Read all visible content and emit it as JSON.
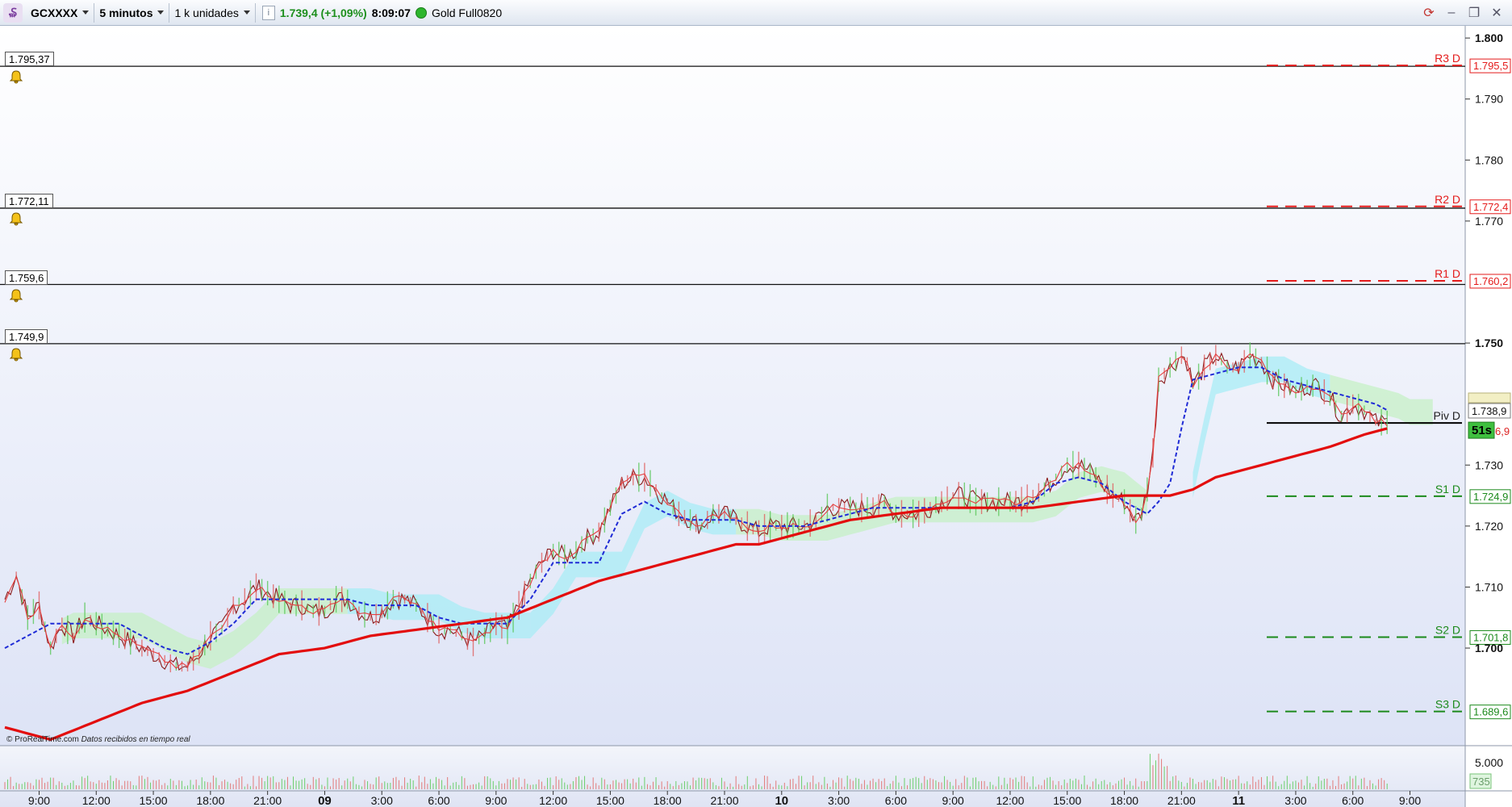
{
  "toolbar": {
    "instrument": "GCXXXX",
    "timeframe": "5 minutos",
    "units": "1 k unidades",
    "info_icon": "i",
    "price": "1.739,4 (+1,09%)",
    "time": "8:09:07",
    "product": "Gold Full0820"
  },
  "attribution": {
    "brand": "© ProRealTime.com",
    "note": "Datos recibidos en tiempo real"
  },
  "alerts": [
    {
      "label": "1.795,37",
      "value": 1795.37
    },
    {
      "label": "1.772,11",
      "value": 1772.11
    },
    {
      "label": "1.759,6",
      "value": 1759.6
    },
    {
      "label": "1.749,9",
      "value": 1749.9
    }
  ],
  "pivots": [
    {
      "name": "R3 D",
      "value": 1795.5,
      "label": "1.795,5",
      "color": "#e41b1b"
    },
    {
      "name": "R2 D",
      "value": 1772.4,
      "label": "1.772,4",
      "color": "#e41b1b"
    },
    {
      "name": "R1 D",
      "value": 1760.2,
      "label": "1.760,2",
      "color": "#e41b1b"
    },
    {
      "name": "Piv D",
      "value": 1736.9,
      "label": "",
      "color": "#000000"
    },
    {
      "name": "S1 D",
      "value": 1724.9,
      "label": "1.724,9",
      "color": "#1c8a1c"
    },
    {
      "name": "S2 D",
      "value": 1701.8,
      "label": "1.701,8",
      "color": "#1c8a1c"
    },
    {
      "name": "S3 D",
      "value": 1689.6,
      "label": "1.689,6",
      "color": "#1c8a1c"
    }
  ],
  "current_price_label": "1.738,9",
  "countdown": "51s",
  "partial_label": "6,9",
  "volume_axis": {
    "tick": "5.000",
    "current": "735"
  },
  "colors": {
    "sma": "#e30d0d",
    "kijun": "#1f2bd6",
    "price": "#8b1a1a",
    "cloud_bull": "#c5f0c5",
    "cloud_bear": "#a8ecf5"
  },
  "chart_data": {
    "type": "line",
    "ylim": [
      1684,
      1802
    ],
    "y_ticks": [
      {
        "v": 1800,
        "t": "1.800",
        "bold": true
      },
      {
        "v": 1790,
        "t": "1.790"
      },
      {
        "v": 1780,
        "t": "1.780"
      },
      {
        "v": 1770,
        "t": "1.770"
      },
      {
        "v": 1750,
        "t": "1.750",
        "bold": true
      },
      {
        "v": 1730,
        "t": "1.730"
      },
      {
        "v": 1720,
        "t": "1.720"
      },
      {
        "v": 1710,
        "t": "1.710"
      },
      {
        "v": 1700,
        "t": "1.700",
        "bold": true
      }
    ],
    "x_ticks": [
      {
        "i": 6,
        "t": "9:00"
      },
      {
        "i": 16,
        "t": "12:00"
      },
      {
        "i": 26,
        "t": "15:00"
      },
      {
        "i": 36,
        "t": "18:00"
      },
      {
        "i": 46,
        "t": "21:00"
      },
      {
        "i": 56,
        "t": "09",
        "bold": true
      },
      {
        "i": 66,
        "t": "3:00"
      },
      {
        "i": 76,
        "t": "6:00"
      },
      {
        "i": 86,
        "t": "9:00"
      },
      {
        "i": 96,
        "t": "12:00"
      },
      {
        "i": 106,
        "t": "15:00"
      },
      {
        "i": 116,
        "t": "18:00"
      },
      {
        "i": 126,
        "t": "21:00"
      },
      {
        "i": 136,
        "t": "10",
        "bold": true
      },
      {
        "i": 146,
        "t": "3:00"
      },
      {
        "i": 156,
        "t": "6:00"
      },
      {
        "i": 166,
        "t": "9:00"
      },
      {
        "i": 176,
        "t": "12:00"
      },
      {
        "i": 186,
        "t": "15:00"
      },
      {
        "i": 196,
        "t": "18:00"
      },
      {
        "i": 206,
        "t": "21:00"
      },
      {
        "i": 216,
        "t": "11",
        "bold": true
      },
      {
        "i": 226,
        "t": "3:00"
      },
      {
        "i": 236,
        "t": "6:00"
      },
      {
        "i": 246,
        "t": "9:00"
      }
    ],
    "price_points": [
      [
        0,
        1708
      ],
      [
        2,
        1712
      ],
      [
        4,
        1705
      ],
      [
        6,
        1707
      ],
      [
        8,
        1700
      ],
      [
        10,
        1704
      ],
      [
        12,
        1702
      ],
      [
        14,
        1705
      ],
      [
        16,
        1704
      ],
      [
        18,
        1703
      ],
      [
        20,
        1702
      ],
      [
        22,
        1701
      ],
      [
        24,
        1700
      ],
      [
        26,
        1699
      ],
      [
        28,
        1698
      ],
      [
        30,
        1697
      ],
      [
        32,
        1697
      ],
      [
        34,
        1699
      ],
      [
        36,
        1702
      ],
      [
        38,
        1703
      ],
      [
        40,
        1707
      ],
      [
        42,
        1708
      ],
      [
        44,
        1710
      ],
      [
        46,
        1709
      ],
      [
        48,
        1708
      ],
      [
        50,
        1707
      ],
      [
        52,
        1707
      ],
      [
        54,
        1706
      ],
      [
        56,
        1706
      ],
      [
        58,
        1708
      ],
      [
        60,
        1708
      ],
      [
        62,
        1706
      ],
      [
        64,
        1705
      ],
      [
        66,
        1706
      ],
      [
        68,
        1708
      ],
      [
        70,
        1708
      ],
      [
        72,
        1707
      ],
      [
        74,
        1705
      ],
      [
        76,
        1703
      ],
      [
        78,
        1703
      ],
      [
        80,
        1702
      ],
      [
        82,
        1701
      ],
      [
        84,
        1702
      ],
      [
        86,
        1704
      ],
      [
        88,
        1703
      ],
      [
        90,
        1707
      ],
      [
        92,
        1711
      ],
      [
        94,
        1714
      ],
      [
        96,
        1716
      ],
      [
        98,
        1715
      ],
      [
        100,
        1716
      ],
      [
        102,
        1718
      ],
      [
        104,
        1719
      ],
      [
        106,
        1723
      ],
      [
        108,
        1727
      ],
      [
        110,
        1728
      ],
      [
        112,
        1728
      ],
      [
        114,
        1726
      ],
      [
        116,
        1724
      ],
      [
        118,
        1722
      ],
      [
        120,
        1721
      ],
      [
        122,
        1720
      ],
      [
        124,
        1722
      ],
      [
        126,
        1722
      ],
      [
        128,
        1721
      ],
      [
        130,
        1720
      ],
      [
        132,
        1719
      ],
      [
        134,
        1720
      ],
      [
        136,
        1720
      ],
      [
        138,
        1720
      ],
      [
        140,
        1720
      ],
      [
        142,
        1721
      ],
      [
        144,
        1723
      ],
      [
        146,
        1723
      ],
      [
        148,
        1723
      ],
      [
        150,
        1723
      ],
      [
        152,
        1723
      ],
      [
        154,
        1724
      ],
      [
        156,
        1722
      ],
      [
        158,
        1722
      ],
      [
        160,
        1722
      ],
      [
        162,
        1723
      ],
      [
        164,
        1724
      ],
      [
        166,
        1725
      ],
      [
        168,
        1725
      ],
      [
        170,
        1724
      ],
      [
        172,
        1724
      ],
      [
        174,
        1724
      ],
      [
        176,
        1724
      ],
      [
        178,
        1724
      ],
      [
        180,
        1725
      ],
      [
        182,
        1726
      ],
      [
        184,
        1728
      ],
      [
        186,
        1730
      ],
      [
        188,
        1730
      ],
      [
        190,
        1729
      ],
      [
        192,
        1727
      ],
      [
        194,
        1725
      ],
      [
        196,
        1724
      ],
      [
        198,
        1721
      ],
      [
        199,
        1722
      ],
      [
        200,
        1726
      ],
      [
        201,
        1732
      ],
      [
        202,
        1744
      ],
      [
        204,
        1746
      ],
      [
        206,
        1748
      ],
      [
        207,
        1747
      ],
      [
        208,
        1743
      ],
      [
        210,
        1746
      ],
      [
        212,
        1748
      ],
      [
        214,
        1746
      ],
      [
        216,
        1746
      ],
      [
        218,
        1748
      ],
      [
        220,
        1747
      ],
      [
        222,
        1744
      ],
      [
        224,
        1743
      ],
      [
        226,
        1742
      ],
      [
        228,
        1743
      ],
      [
        230,
        1743
      ],
      [
        232,
        1741
      ],
      [
        234,
        1738
      ],
      [
        236,
        1740
      ],
      [
        238,
        1739
      ],
      [
        240,
        1737
      ],
      [
        242,
        1737
      ]
    ],
    "kijun_points": [
      [
        0,
        1700
      ],
      [
        4,
        1702
      ],
      [
        8,
        1704
      ],
      [
        12,
        1704
      ],
      [
        16,
        1704
      ],
      [
        20,
        1704
      ],
      [
        24,
        1702
      ],
      [
        28,
        1700
      ],
      [
        32,
        1699
      ],
      [
        36,
        1701
      ],
      [
        40,
        1704
      ],
      [
        44,
        1708
      ],
      [
        48,
        1708
      ],
      [
        52,
        1708
      ],
      [
        56,
        1708
      ],
      [
        60,
        1708
      ],
      [
        64,
        1707
      ],
      [
        68,
        1707
      ],
      [
        72,
        1707
      ],
      [
        76,
        1705
      ],
      [
        80,
        1704
      ],
      [
        84,
        1704
      ],
      [
        88,
        1704
      ],
      [
        92,
        1708
      ],
      [
        96,
        1714
      ],
      [
        100,
        1714
      ],
      [
        104,
        1714
      ],
      [
        108,
        1722
      ],
      [
        112,
        1724
      ],
      [
        116,
        1722
      ],
      [
        120,
        1721
      ],
      [
        124,
        1721
      ],
      [
        128,
        1721
      ],
      [
        132,
        1720
      ],
      [
        136,
        1720
      ],
      [
        140,
        1720
      ],
      [
        144,
        1721
      ],
      [
        148,
        1722
      ],
      [
        152,
        1723
      ],
      [
        156,
        1723
      ],
      [
        160,
        1723
      ],
      [
        164,
        1723
      ],
      [
        168,
        1723
      ],
      [
        172,
        1723
      ],
      [
        176,
        1723
      ],
      [
        180,
        1724
      ],
      [
        184,
        1727
      ],
      [
        188,
        1728
      ],
      [
        192,
        1727
      ],
      [
        196,
        1724
      ],
      [
        200,
        1722
      ],
      [
        202,
        1724
      ],
      [
        204,
        1727
      ],
      [
        206,
        1736
      ],
      [
        208,
        1744
      ],
      [
        212,
        1745
      ],
      [
        216,
        1746
      ],
      [
        220,
        1746
      ],
      [
        224,
        1744
      ],
      [
        228,
        1743
      ],
      [
        232,
        1742
      ],
      [
        236,
        1741
      ],
      [
        240,
        1740
      ],
      [
        242,
        1739
      ]
    ],
    "sma_points": [
      [
        0,
        1687
      ],
      [
        8,
        1685
      ],
      [
        16,
        1688
      ],
      [
        24,
        1691
      ],
      [
        32,
        1693
      ],
      [
        40,
        1696
      ],
      [
        48,
        1699
      ],
      [
        56,
        1700
      ],
      [
        64,
        1702
      ],
      [
        72,
        1703
      ],
      [
        80,
        1704
      ],
      [
        88,
        1705
      ],
      [
        96,
        1708
      ],
      [
        104,
        1711
      ],
      [
        112,
        1713
      ],
      [
        120,
        1715
      ],
      [
        128,
        1717
      ],
      [
        132,
        1717
      ],
      [
        140,
        1719
      ],
      [
        148,
        1721
      ],
      [
        156,
        1722
      ],
      [
        164,
        1723
      ],
      [
        172,
        1723
      ],
      [
        180,
        1723
      ],
      [
        188,
        1724
      ],
      [
        196,
        1725
      ],
      [
        204,
        1725
      ],
      [
        208,
        1726
      ],
      [
        212,
        1728
      ],
      [
        216,
        1729
      ],
      [
        224,
        1731
      ],
      [
        232,
        1733
      ],
      [
        238,
        1735
      ],
      [
        242,
        1736
      ]
    ]
  }
}
